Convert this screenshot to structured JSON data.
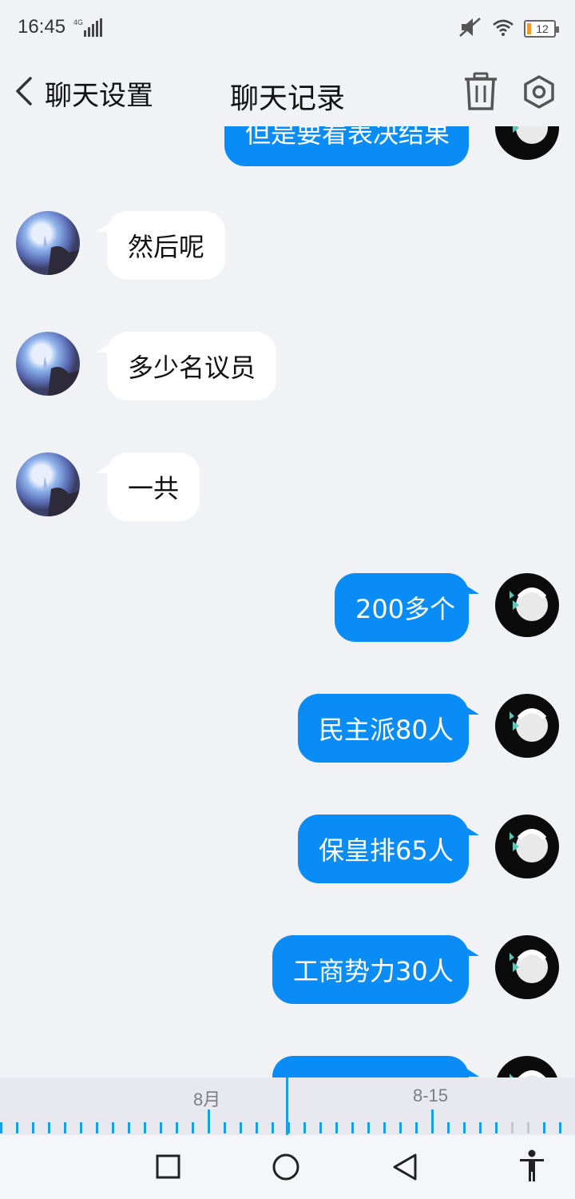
{
  "status_bar": {
    "time": "16:45",
    "network": "4G",
    "battery": "12",
    "icons": [
      "signal-icon",
      "mute-icon",
      "wifi-icon",
      "battery-icon"
    ]
  },
  "header": {
    "back_label": "聊天设置",
    "title": "聊天记录",
    "icons": [
      "back-chevron-icon",
      "trash-icon",
      "gear-icon"
    ]
  },
  "messages": [
    {
      "side": "me",
      "text": "但是要看表决结果"
    },
    {
      "side": "them",
      "text": "然后呢"
    },
    {
      "side": "them",
      "text": "多少名议员"
    },
    {
      "side": "them",
      "text": "一共"
    },
    {
      "side": "me",
      "text": "200多个"
    },
    {
      "side": "me",
      "text": "民主派80人"
    },
    {
      "side": "me",
      "text": "保皇排65人"
    },
    {
      "side": "me",
      "text": "工商势力30人"
    },
    {
      "side": "me",
      "text": ""
    }
  ],
  "timeline": {
    "labels": [
      "8月",
      "8-15"
    ]
  },
  "navbar": {
    "icons": [
      "recents-square-icon",
      "home-circle-icon",
      "back-triangle-icon",
      "accessibility-icon"
    ]
  },
  "colors": {
    "accent": "#0a8cf6",
    "background": "#f1f2f6",
    "timeline_tick": "#1aa0e0"
  }
}
